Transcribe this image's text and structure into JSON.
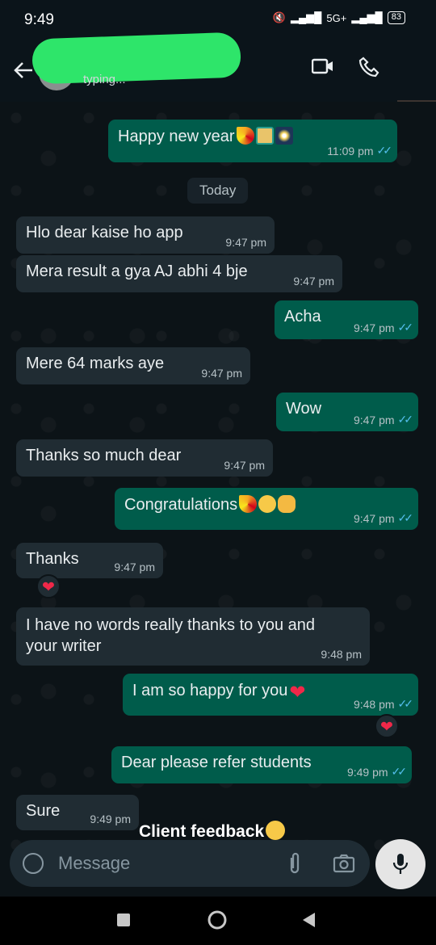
{
  "status": {
    "time": "9:49",
    "battery": "83",
    "network": "5G+"
  },
  "header": {
    "subtitle": "typing..."
  },
  "chat": {
    "day_divider": "Today",
    "messages": [
      {
        "dir": "out",
        "text": "Happy new year",
        "time": "11:09 pm",
        "emojis": [
          "party-popper",
          "wrapped-gift",
          "fireworks"
        ]
      },
      {
        "dir": "in",
        "text": "Hlo dear kaise ho app",
        "time": "9:47 pm"
      },
      {
        "dir": "in",
        "text": "Mera result a gya AJ abhi 4 bje",
        "time": "9:47 pm"
      },
      {
        "dir": "out",
        "text": "Acha",
        "time": "9:47 pm"
      },
      {
        "dir": "in",
        "text": "Mere 64 marks aye",
        "time": "9:47 pm"
      },
      {
        "dir": "out",
        "text": "Wow",
        "time": "9:47 pm"
      },
      {
        "dir": "in",
        "text": "Thanks so much dear",
        "time": "9:47 pm"
      },
      {
        "dir": "out",
        "text": "Congratulations",
        "time": "9:47 pm",
        "emojis": [
          "party-popper",
          "partying-face",
          "clapping-hands"
        ]
      },
      {
        "dir": "in",
        "text": "Thanks",
        "time": "9:47 pm",
        "reaction": "heart"
      },
      {
        "dir": "in",
        "text_line1": "I have no words really thanks to you and",
        "text_line2": "your writer",
        "time": "9:48 pm"
      },
      {
        "dir": "out",
        "text": "I am so happy for you",
        "time": "9:48 pm",
        "emojis": [
          "heart"
        ],
        "reaction": "heart"
      },
      {
        "dir": "out",
        "text": "Dear please refer students",
        "time": "9:49 pm"
      },
      {
        "dir": "in",
        "text": "Sure",
        "time": "9:49 pm"
      }
    ]
  },
  "caption": "Client feedback",
  "composer": {
    "placeholder": "Message"
  },
  "colors": {
    "incoming": "#202c33",
    "outgoing": "#005c4b",
    "ticks": "#53bdeb",
    "background": "#0c1317",
    "redaction": "#2ee56a"
  }
}
